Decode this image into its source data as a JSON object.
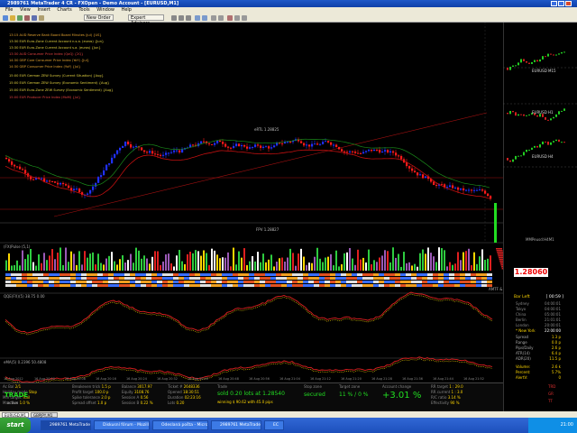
{
  "window": {
    "title": "2989761 MetaTrader 4 CR - FXOpen - Demo Account - [EURUSD,M1]"
  },
  "menu": [
    "File",
    "View",
    "Insert",
    "Charts",
    "Tools",
    "Window",
    "Help"
  ],
  "toolbar": {
    "new_order": "New Order",
    "expert_advisors": "Expert Advisors"
  },
  "news": [
    {
      "text": "13:15  AUD  Reserve Bank Board Board Minutes (Jul) {US}",
      "color": "#e0a030"
    },
    {
      "text": "13:30  EUR  Euro-Zone Current Account n.s.a. (euros) {Jun}",
      "color": "#e0d040"
    },
    {
      "text": "13:30  EUR  Euro-Zone Current Account s.a. (euros) {Jun}",
      "color": "#e0d040"
    },
    {
      "text": "13:30  AUD  Consumer Price Index (QoQ) {2Q}",
      "color": "#e04040"
    },
    {
      "text": "14:30  GBP  Core Consumer Price Index (YoY) {Jul}",
      "color": "#e0a030"
    },
    {
      "text": "14:30  GBP  Consumer Price Index (YoY) {Jul}",
      "color": "#e0a030"
    },
    {
      "text": "15:00  EUR  German ZEW Survey (Current Situation) {Aug}",
      "color": "#e0d040"
    },
    {
      "text": "15:00  EUR  German ZEW Survey (Economic Sentiment) {Aug}",
      "color": "#e0d040"
    },
    {
      "text": "15:00  EUR  Euro-Zone ZEW Survey (Economic Sentiment) {Aug}",
      "color": "#e0d040"
    },
    {
      "text": "15:00  EUR  Producer Price Index (MoM) {Jul}",
      "color": "#e04040"
    }
  ],
  "labels": {
    "label_a": "eRTL  1.28825",
    "label_b": "FPV  1.28827",
    "panel_a": "EURUSD M15",
    "panel_b": "EURUSD H1",
    "panel_c": "EURUSD H4",
    "mmpeusd": "MMPeusd:H4M1",
    "price_box": "1.28060"
  },
  "indicator_labels": {
    "sub1": "(FX)Pulse (5,1)",
    "sub2": "QQE(FX)(5) 38.75 0.00",
    "sub3": "eMA(5) 0.2396 50.4808",
    "atr": "AMTF & MoPro"
  },
  "sessions": {
    "bar_left_label": "Bar Left",
    "bar_left_value": "[ 00:59 ]",
    "rows": [
      {
        "name": "Sydney",
        "time": "04:00:01"
      },
      {
        "name": "Tokyo",
        "time": "04:00:01"
      },
      {
        "name": "China",
        "time": "05:00:01"
      },
      {
        "name": "Berlin",
        "time": "21:01:01"
      },
      {
        "name": "London",
        "time": "20:00:01"
      },
      {
        "name": "* New York",
        "time": "22:00:00"
      }
    ],
    "stats": [
      {
        "name": "Spread",
        "value": "1.3 p"
      },
      {
        "name": "Range",
        "value": "0.0 p"
      },
      {
        "name": "Pips/Daily",
        "value": "2.6 p"
      },
      {
        "name": "ATR(14)",
        "value": "6.4 p"
      },
      {
        "name": "ADR(20)",
        "value": "11.5 p"
      }
    ],
    "volume": [
      {
        "name": "Volume:",
        "value": "2.6 k"
      },
      {
        "name": "Percent:",
        "value": "5.7%"
      },
      {
        "name": "AlertV:",
        "value": "0"
      }
    ]
  },
  "bottom_panel": {
    "left": [
      {
        "name": "Ac Bal",
        "value": "2/1"
      },
      {
        "name": "Holiday mode",
        "value": "Stop"
      },
      {
        "name": "Min target",
        "value": "Trail"
      },
      {
        "name": "Max loss",
        "value": "1.0 %"
      }
    ],
    "trade_status": "TRADE",
    "active": "active",
    "col2": [
      {
        "name": "Breakeven trick",
        "value": "1.5 p"
      },
      {
        "name": "Profit target",
        "value": "100.0 p"
      },
      {
        "name": "Spike tolerance",
        "value": "2.0 p"
      },
      {
        "name": "Spread offset",
        "value": "1.0 p"
      }
    ],
    "col3": [
      {
        "name": "Balance",
        "value": "3017.97"
      },
      {
        "name": "Equity",
        "value": "3108.76"
      },
      {
        "name": "Session A",
        "value": "0.56"
      },
      {
        "name": "Session B",
        "value": "0.22 %"
      }
    ],
    "col4": [
      {
        "name": "Ticket #",
        "value": "2648336"
      },
      {
        "name": "Opened",
        "value": "18:30:51"
      },
      {
        "name": "Duration",
        "value": "02:23:16"
      },
      {
        "name": "Lots",
        "value": "0.20"
      }
    ],
    "trade_title": "Trade",
    "trade_text": "sold 0.20 lots at 1.28540",
    "winning": "winning $ 90.62 with 45.0 pips",
    "stop_zone": "Stop zone",
    "secured": "secured",
    "target_zone": "Target zone",
    "target_pct": "11 % / 0 %",
    "account_change": "Account change",
    "account_pct": "+3.01 %",
    "right_col": [
      {
        "name": "RR target",
        "value": "1 : 29.0"
      },
      {
        "name": "RR current",
        "value": "1 : 3.0"
      },
      {
        "name": "R/C ratio",
        "value": "3.14 %"
      },
      {
        "name": "Effectivity",
        "value": "90 %"
      }
    ],
    "tags": [
      "TRD",
      "GR",
      "TT"
    ]
  },
  "tabs": [
    "EURUSD,M1",
    "GBPJPY,M1"
  ],
  "taskbar": {
    "start": "start",
    "tasks": [
      "2989761 MetaTrader ...",
      "Diskusní fórum - Mozilla F...",
      "Odeslaná pošta - Micros...",
      "2989761 MetaTrader ...",
      "EC"
    ],
    "clock": "21:00"
  },
  "x_ticks": [
    "16 Aug 2012",
    "16 Aug 20:00",
    "16 Aug 20:08",
    "16 Aug 20:16",
    "16 Aug 20:24",
    "16 Aug 20:32",
    "16 Aug 20:40",
    "16 Aug 20:48",
    "16 Aug 20:56",
    "16 Aug 21:04",
    "16 Aug 21:12",
    "16 Aug 21:20",
    "16 Aug 21:28",
    "16 Aug 21:36",
    "16 Aug 21:44",
    "16 Aug 21:52"
  ],
  "colors": {
    "up": "#2030ff",
    "down": "#ff1a1a",
    "ma": "#c01010",
    "ma2": "#1a8a1a",
    "green": "#22dd22"
  }
}
